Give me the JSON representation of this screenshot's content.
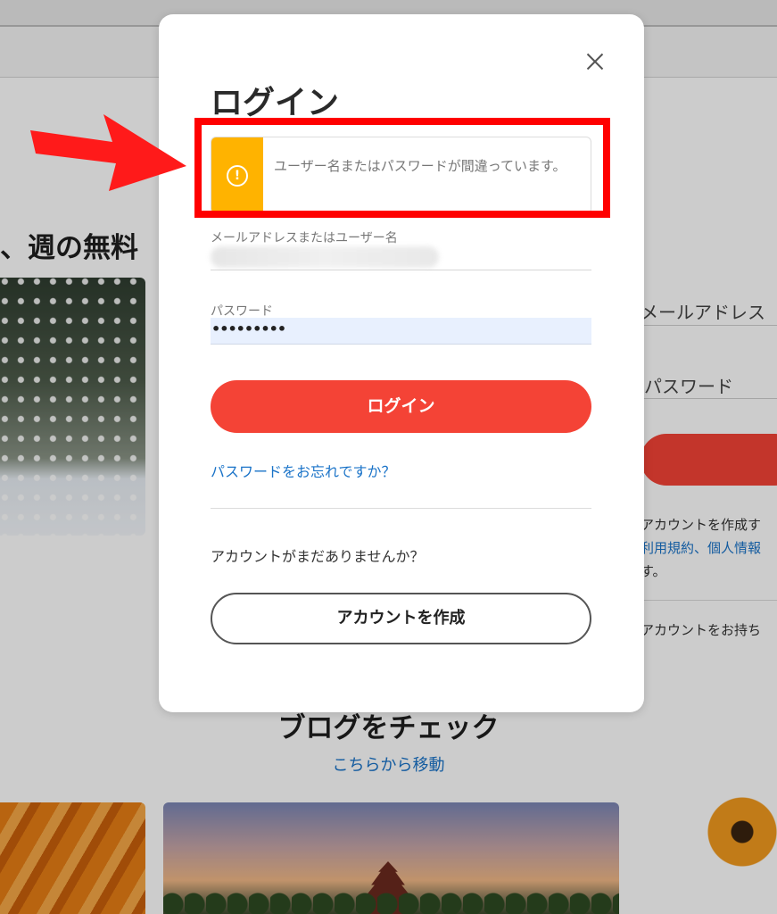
{
  "background": {
    "heading": "、週の無料",
    "form": {
      "email_placeholder": "メールアドレス",
      "password_placeholder": "パスワード",
      "terms_line1": "アカウントを作成す",
      "terms_line2": "利用規約、個人情報",
      "terms_line3": "す。",
      "have_account": "アカウントをお持ち"
    },
    "blog": {
      "title": "ブログをチェック",
      "link": "こちらから移動"
    }
  },
  "modal": {
    "title": "ログイン",
    "close_icon": "close-icon",
    "alert": {
      "icon": "exclamation-circle-icon",
      "message": "ユーザー名またはパスワードが間違っています。",
      "color": "#ffb300"
    },
    "email_label": "メールアドレスまたはユーザー名",
    "password_label": "パスワード",
    "password_value": "•••••••••",
    "login_button": "ログイン",
    "forgot_link": "パスワードをお忘れですか？",
    "no_account_text": "アカウントがまだありませんか？",
    "create_account_button": "アカウントを作成"
  },
  "colors": {
    "primary_red": "#f44336",
    "link_blue": "#1a73c8",
    "highlight_red": "#ff0000"
  }
}
